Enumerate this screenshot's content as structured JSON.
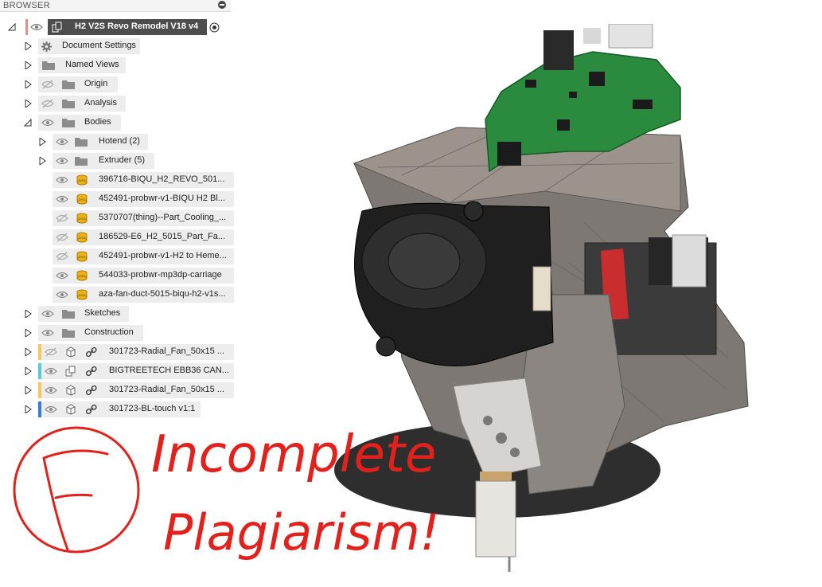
{
  "browser": {
    "header": "BROWSER",
    "root": "H2 V2S Revo Remodel V18 v4",
    "items": [
      {
        "label": "Document Settings"
      },
      {
        "label": "Named Views"
      },
      {
        "label": "Origin"
      },
      {
        "label": "Analysis"
      },
      {
        "label": "Bodies"
      },
      {
        "label": "Hotend (2)"
      },
      {
        "label": "Extruder (5)"
      },
      {
        "label": "396716-BIQU_H2_REVO_501..."
      },
      {
        "label": "452491-probwr-v1-BIQU H2 Bl..."
      },
      {
        "label": "5370707(thing)--Part_Cooling_..."
      },
      {
        "label": "186529-E6_H2_5015_Part_Fa..."
      },
      {
        "label": "452491-probwr-v1-H2 to Heme..."
      },
      {
        "label": "544033-probwr-mp3dp-carriage"
      },
      {
        "label": "aza-fan-duct-5015-biqu-h2-v1s..."
      },
      {
        "label": "Sketches"
      },
      {
        "label": "Construction"
      },
      {
        "label": "301723-Radial_Fan_50x15 ..."
      },
      {
        "label": "BIGTREETECH EBB36 CAN..."
      },
      {
        "label": "301723-Radial_Fan_50x15 ..."
      },
      {
        "label": "301723-BL-touch v1:1"
      }
    ],
    "component_colors": [
      "#f5c75a",
      "#5cc8d8",
      "#f5c75a",
      "#3a78d4"
    ]
  },
  "annotation": {
    "grade": "F",
    "line1": "Incomplete",
    "line2": "Plagiarism!",
    "color": "#e3211c"
  },
  "icons": [
    "eye-icon",
    "eye-hidden-icon",
    "folder-icon",
    "gear-icon",
    "body-icon",
    "component-icon",
    "link-icon",
    "radio-icon",
    "expand-icon",
    "collapse-icon"
  ]
}
